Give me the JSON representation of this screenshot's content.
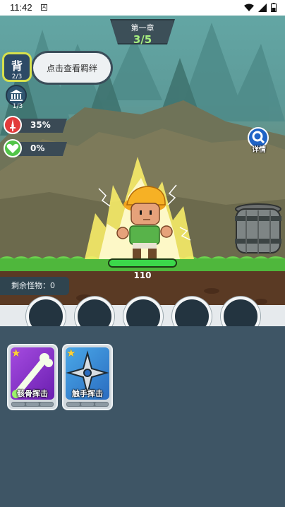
{
  "status_bar": {
    "time": "11:42",
    "notif_glyph": "A"
  },
  "chapter": {
    "title": "第一章",
    "progress": "3/5"
  },
  "left_panel": {
    "bag": {
      "label": "背",
      "count": "2/3"
    },
    "bond_hint": "点击查看羁绊",
    "hall": {
      "count": "1/3"
    }
  },
  "stats": {
    "attack": "35%",
    "heal": "0%"
  },
  "detail_label": "详情",
  "player": {
    "hp": "110",
    "hp_fraction": 1.0
  },
  "remaining_monsters": "剩余怪物：0",
  "skill_slots": 5,
  "cards": [
    {
      "name": "骸骨挥击",
      "stars": 1,
      "icon": "bone-club-icon"
    },
    {
      "name": "触手挥击",
      "stars": 1,
      "icon": "shuriken-icon"
    }
  ],
  "colors": {
    "accent_green": "#3bd84a",
    "chapter_progress": "#a6ef7f",
    "panel_bg": "#3e5565"
  }
}
